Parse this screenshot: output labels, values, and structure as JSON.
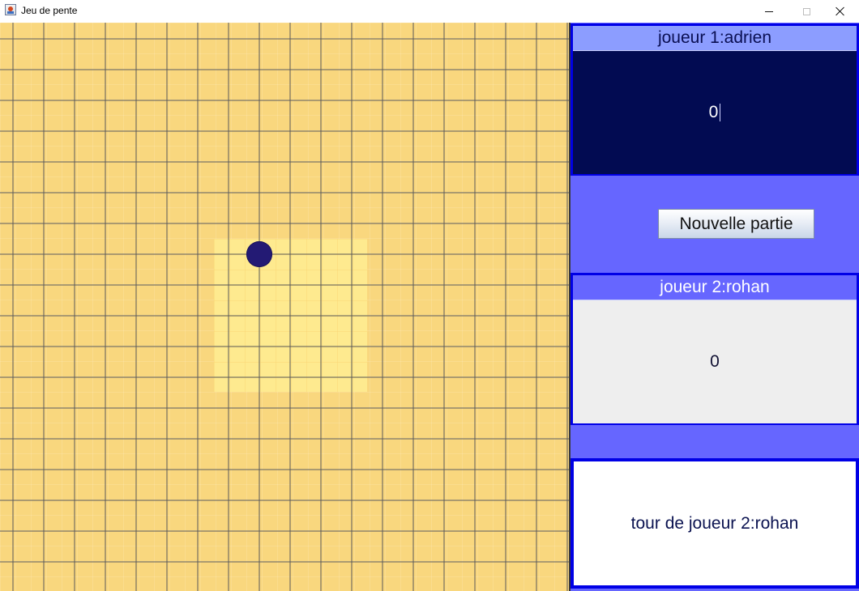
{
  "window": {
    "title": "Jeu de pente",
    "icon": "java-cup-icon",
    "controls": [
      "minimize",
      "maximize",
      "close"
    ]
  },
  "board": {
    "size": 37,
    "colors": {
      "board": "#f9d77e",
      "center_zone": "#feea8f",
      "grid_line": "#5a5a5a",
      "stone_player1": "#231a74"
    },
    "stones": [
      {
        "player": 1,
        "col": 16,
        "row": 15
      }
    ]
  },
  "players": {
    "p1": {
      "label": "joueur 1:adrien",
      "score": "0"
    },
    "p2": {
      "label": "joueur 2:rohan",
      "score": "0"
    }
  },
  "new_game_label": "Nouvelle partie",
  "turn_text": "tour de joueur 2:rohan",
  "colors": {
    "panel": "#6666ff",
    "panel_border": "#0000e6",
    "p1_header": "#8c9dff",
    "p1_score_bg": "#020b52"
  }
}
